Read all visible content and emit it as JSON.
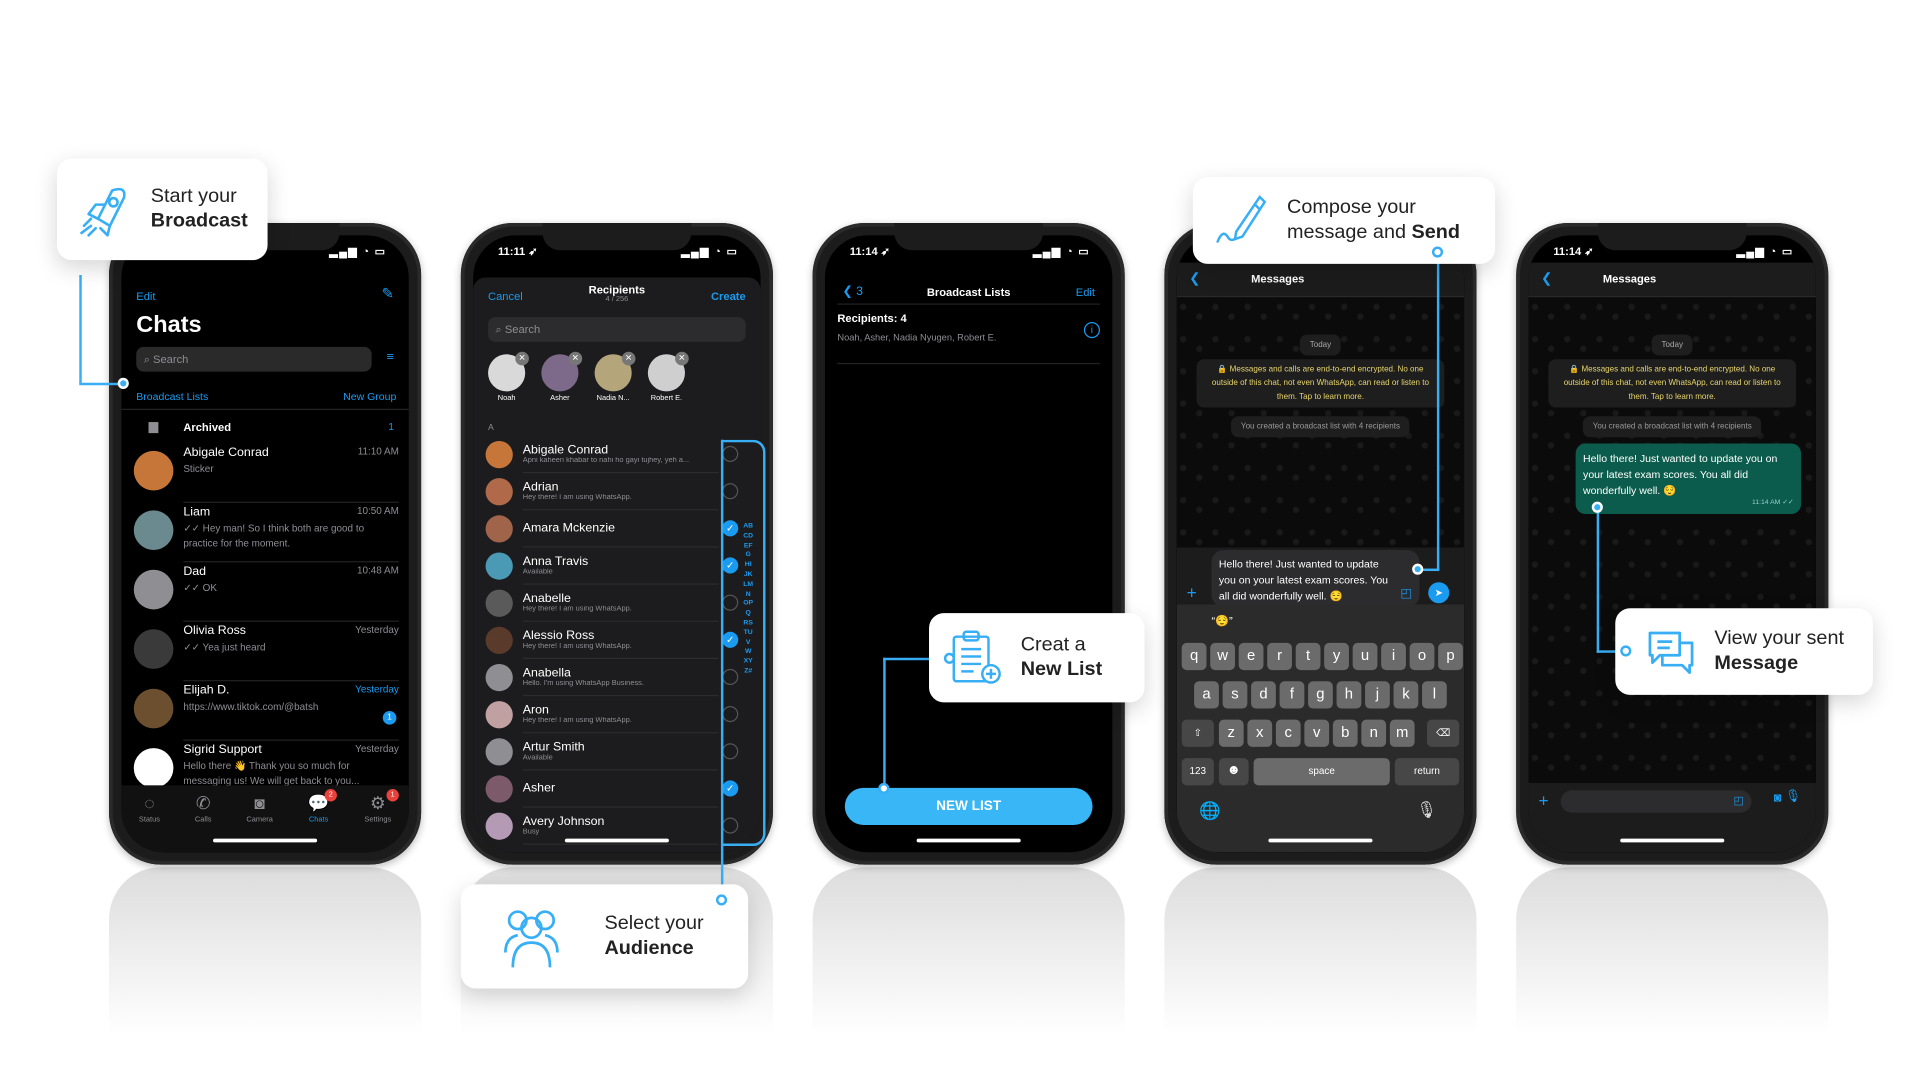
{
  "callouts": {
    "start": {
      "line1": "Start your",
      "line2": "Broadcast",
      "icon": "rocket-icon"
    },
    "audience": {
      "line1": "Select your",
      "line2": "Audience",
      "icon": "users-icon"
    },
    "newlist": {
      "line1": "Creat a",
      "line2": "New List",
      "icon": "clipboard-add-icon"
    },
    "compose": {
      "line1": "Compose your",
      "line2_prefix": "message and ",
      "line2_bold": "Send",
      "icon": "pen-icon"
    },
    "view": {
      "line1": "View your sent",
      "line2": "Message",
      "icon": "chat-bubbles-icon"
    }
  },
  "accent": "#38aef5",
  "phone1": {
    "edit": "Edit",
    "title": "Chats",
    "search_placeholder": "Search",
    "broadcast_lists": "Broadcast Lists",
    "new_group": "New Group",
    "archived": {
      "label": "Archived",
      "count": "1"
    },
    "chats": [
      {
        "name": "Abigale Conrad",
        "msg": "Sticker",
        "time": "11:10 AM",
        "color": "#c7763a"
      },
      {
        "name": "Liam",
        "msg": "✓✓ Hey man! So I think both are good to practice for the moment.",
        "time": "10:50 AM",
        "color": "#6a8a8f"
      },
      {
        "name": "Dad",
        "msg": "✓✓ OK",
        "time": "10:48 AM",
        "color": "#8e8e93"
      },
      {
        "name": "Olivia Ross",
        "msg": "✓✓ Yea just heard",
        "time": "Yesterday",
        "color": "#3a3a3a"
      },
      {
        "name": "Elijah D.",
        "msg": "https://www.tiktok.com/@batsh",
        "time": "Yesterday",
        "unread": "1",
        "color": "#6b4f2f"
      },
      {
        "name": "Sigrid Support",
        "msg": "Hello there 👋 Thank you so much for messaging us! We will get back to you...",
        "time": "Yesterday",
        "color": "#ffffff"
      }
    ],
    "tabs": [
      {
        "label": "Status",
        "icon": "status-icon",
        "glyph": "◌"
      },
      {
        "label": "Calls",
        "icon": "phone-icon",
        "glyph": "✆"
      },
      {
        "label": "Camera",
        "icon": "camera-icon",
        "glyph": "◙"
      },
      {
        "label": "Chats",
        "icon": "chats-icon",
        "glyph": "💬",
        "badge": "2",
        "active": true
      },
      {
        "label": "Settings",
        "icon": "settings-icon",
        "glyph": "⚙",
        "badge": "1"
      }
    ]
  },
  "phone2": {
    "time": "11:11",
    "cancel": "Cancel",
    "title": "Recipients",
    "count": "4 / 256",
    "create": "Create",
    "search_placeholder": "Search",
    "selected": [
      {
        "name": "Noah",
        "color": "#d9d9d9"
      },
      {
        "name": "Asher",
        "color": "#7d6a8a"
      },
      {
        "name": "Nadia N...",
        "color": "#b5a57a"
      },
      {
        "name": "Robert E.",
        "color": "#cfcfcf"
      }
    ],
    "section": "A",
    "contacts": [
      {
        "name": "Abigale Conrad",
        "status": "Apni kaheen khabar to nahi ho gayi tujhey, yeh a...",
        "checked": false,
        "color": "#c7763a"
      },
      {
        "name": "Adrian",
        "status": "Hey there! I am using WhatsApp.",
        "checked": false,
        "color": "#b06a4a"
      },
      {
        "name": "Amara Mckenzie",
        "status": "",
        "checked": true,
        "color": "#a0644a"
      },
      {
        "name": "Anna Travis",
        "status": "Available",
        "checked": true,
        "color": "#4a9ab5"
      },
      {
        "name": "Anabelle",
        "status": "Hey there! I am using WhatsApp.",
        "checked": false,
        "color": "#5a5a5a"
      },
      {
        "name": "Alessio Ross",
        "status": "Hey there! I am using WhatsApp.",
        "checked": true,
        "color": "#5a3a2a"
      },
      {
        "name": "Anabella",
        "status": "Hello. I'm using WhatsApp Business.",
        "checked": false,
        "color": "#8e8e93"
      },
      {
        "name": "Aron",
        "status": "Hey there! I am using WhatsApp.",
        "checked": false,
        "color": "#c0a0a0"
      },
      {
        "name": "Artur Smith",
        "status": "Available",
        "checked": false,
        "color": "#8e8e93"
      },
      {
        "name": "Asher",
        "status": "",
        "checked": true,
        "color": "#7d5a6a"
      },
      {
        "name": "Avery Johnson",
        "status": "Busy",
        "checked": false,
        "color": "#b59ab5"
      }
    ],
    "alphabet": "ABCDEFGHIJKLMNOPQRSTUVWXYZ#"
  },
  "phone3": {
    "time": "11:14",
    "back_count": "3",
    "title": "Broadcast Lists",
    "edit": "Edit",
    "recipients_label": "Recipients: 4",
    "recipients_names": "Noah, Asher, Nadia Nyugen, Robert E.",
    "new_list_button": "NEW LIST"
  },
  "phone4": {
    "title": "Messages",
    "date_pill": "Today",
    "encryption_notice": "🔒 Messages and calls are end-to-end encrypted. No one outside of this chat, not even WhatsApp, can read or listen to them. Tap to learn more.",
    "system_msg": "You created a broadcast list with 4 recipients",
    "draft": "Hello there! Just wanted to update you on your latest exam scores. You all did wonderfully well. 😌",
    "suggestion": "“😌”",
    "keys_row1": [
      "q",
      "w",
      "e",
      "r",
      "t",
      "y",
      "u",
      "i",
      "o",
      "p"
    ],
    "keys_row2": [
      "a",
      "s",
      "d",
      "f",
      "g",
      "h",
      "j",
      "k",
      "l"
    ],
    "keys_row3": [
      "z",
      "x",
      "c",
      "v",
      "b",
      "n",
      "m"
    ],
    "key_123": "123",
    "key_space": "space",
    "key_return": "return"
  },
  "phone5": {
    "time": "11:14",
    "title": "Messages",
    "date_pill": "Today",
    "encryption_notice": "🔒 Messages and calls are end-to-end encrypted. No one outside of this chat, not even WhatsApp, can read or listen to them. Tap to learn more.",
    "system_msg": "You created a broadcast list with 4 recipients",
    "sent_message": "Hello there! Just wanted to update you on your latest exam scores. You all did wonderfully well. 😌",
    "sent_time": "11:14 AM ✓✓"
  }
}
